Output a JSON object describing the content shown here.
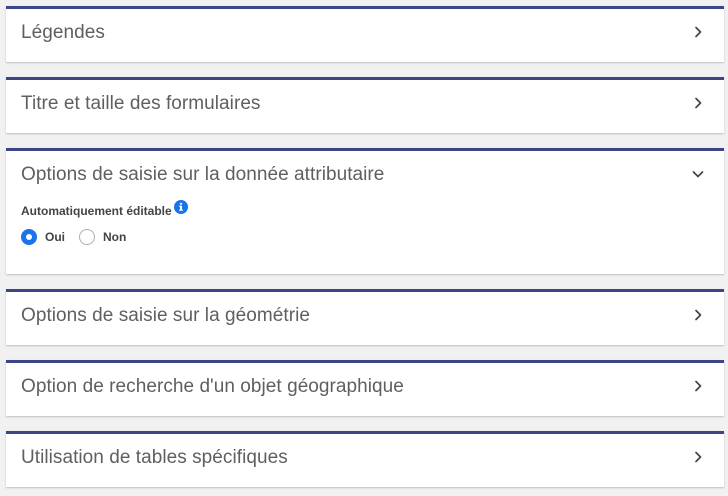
{
  "panels": [
    {
      "title": "Légendes",
      "expanded": false,
      "chevron": "chevron-right-icon"
    },
    {
      "title": "Titre et taille des formulaires",
      "expanded": false,
      "chevron": "chevron-right-icon"
    },
    {
      "title": "Options de saisie sur la donnée attributaire",
      "expanded": true,
      "chevron": "chevron-down-icon",
      "field": {
        "label": "Automatiquement éditable",
        "info_icon": "info-icon",
        "options": [
          {
            "label": "Oui",
            "selected": true
          },
          {
            "label": "Non",
            "selected": false
          }
        ]
      }
    },
    {
      "title": "Options de saisie sur la géométrie",
      "expanded": false,
      "chevron": "chevron-right-icon"
    },
    {
      "title": "Option de recherche d'un objet géographique",
      "expanded": false,
      "chevron": "chevron-right-icon"
    },
    {
      "title": "Utilisation de tables spécifiques",
      "expanded": false,
      "chevron": "chevron-right-icon"
    }
  ],
  "colors": {
    "panel_top_border": "#3c4685",
    "radio_selected": "#1a73e8",
    "info_icon": "#1a73e8",
    "background": "#f1f1f1"
  }
}
